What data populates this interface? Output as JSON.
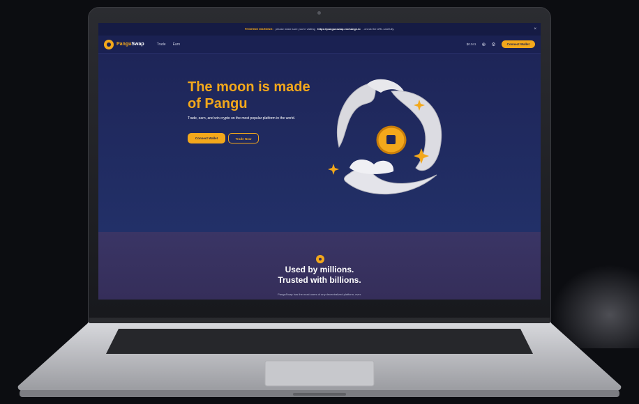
{
  "banner": {
    "warning": "PHISHING WARNING:",
    "text_before": "please make sure you're visiting",
    "url": "https://pangusswap.exchange.io",
    "text_after": "- check the URL carefully.",
    "close": "×"
  },
  "nav": {
    "brand_first": "Pangu",
    "brand_second": "Swap",
    "links": [
      "Trade",
      "Earn"
    ],
    "price": "$0.041",
    "globe_icon": "globe-icon",
    "settings_icon": "gear-icon",
    "connect_label": "Connect Wallet"
  },
  "hero": {
    "title": "The moon is made of Pangu",
    "subtitle": "Trade, earn, and win crypto on the most popular platform in the world.",
    "primary_button": "Connect Wallet",
    "secondary_button": "Trade Now"
  },
  "section": {
    "heading_line1": "Used by millions.",
    "heading_line2": "Trusted with billions.",
    "caption": "PanguSwap has the most users of any decentralized platform, ever."
  },
  "colors": {
    "accent": "#f3a81b",
    "background": "#1e2558",
    "lower_background": "#352e5a"
  }
}
